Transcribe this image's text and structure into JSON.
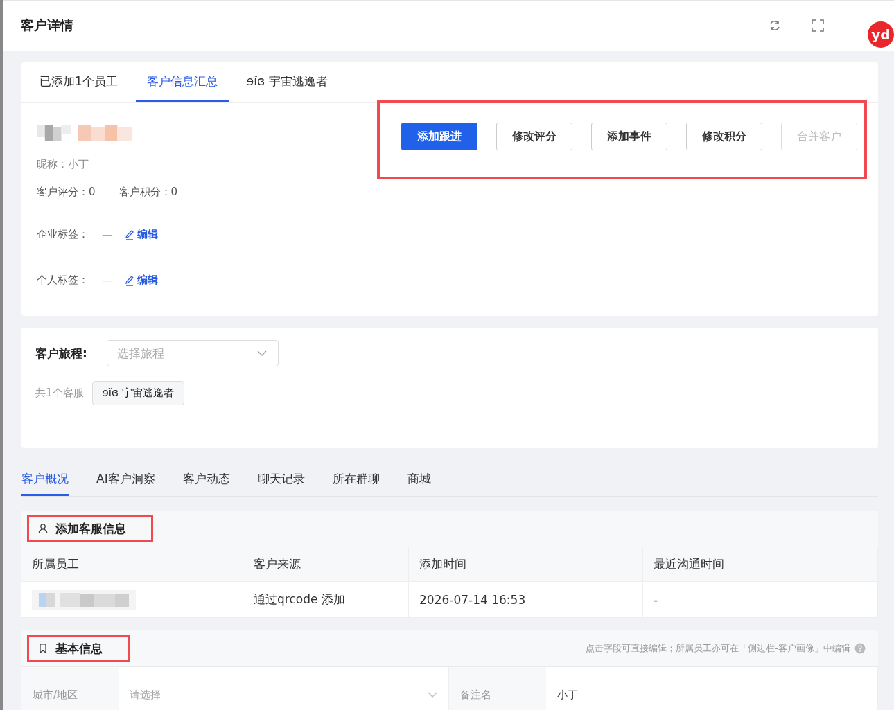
{
  "header": {
    "title": "客户详情",
    "extension_badge": "yd"
  },
  "tabs": [
    {
      "label": "已添加1个员工",
      "selected": false
    },
    {
      "label": "客户信息汇总",
      "selected": true
    },
    {
      "label": "ɘĩɞ 宇宙逃逸者",
      "selected": false
    }
  ],
  "profile": {
    "nickname": "昵称：小丁",
    "score": "客户评分：0",
    "points": "客户积分：0",
    "tags": [
      {
        "label": "企业标签：",
        "value": "—",
        "action": "编辑"
      },
      {
        "label": "个人标签：",
        "value": "—",
        "action": "编辑"
      }
    ]
  },
  "actions": {
    "highlighted": true,
    "buttons": [
      {
        "label": "添加跟进",
        "primary": true,
        "disabled": false
      },
      {
        "label": "修改评分",
        "primary": false,
        "disabled": false
      },
      {
        "label": "添加事件",
        "primary": false,
        "disabled": false
      },
      {
        "label": "修改积分",
        "primary": false,
        "disabled": false
      },
      {
        "label": "合并客户",
        "primary": false,
        "disabled": true
      }
    ]
  },
  "journey": {
    "label": "客户旅程:",
    "placeholder": "选择旅程",
    "count": "共1个客服",
    "agent": "ɘĩɞ 宇宙逃逸者"
  },
  "section_tabs": [
    {
      "label": "客户概况",
      "selected": true
    },
    {
      "label": "AI客户洞察",
      "selected": false
    },
    {
      "label": "客户动态",
      "selected": false
    },
    {
      "label": "聊天记录",
      "selected": false
    },
    {
      "label": "所在群聊",
      "selected": false
    },
    {
      "label": "商城",
      "selected": false
    }
  ],
  "service_info": {
    "title": "添加客服信息",
    "highlighted": true,
    "columns": [
      "所属员工",
      "客户来源",
      "添加时间",
      "最近沟通时间"
    ],
    "rows": [
      {
        "source": "通过qrcode 添加",
        "added": "2026-07-14 16:53",
        "last_contact": "-"
      }
    ]
  },
  "basic_info": {
    "title": "基本信息",
    "highlighted": true,
    "hint": "点击字段可直接编辑；所属员工亦可在「侧边栏-客户画像」中编辑",
    "fields": [
      {
        "label": "城市/地区",
        "kind": "select",
        "placeholder": "请选择"
      },
      {
        "label": "备注名",
        "kind": "text",
        "value": "小丁"
      }
    ]
  }
}
